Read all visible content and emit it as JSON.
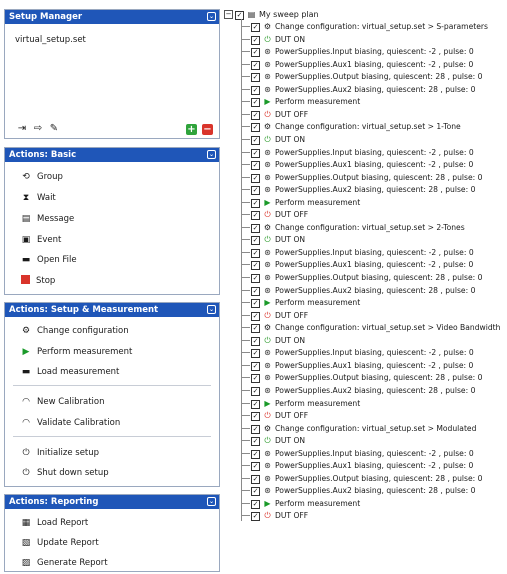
{
  "setup_manager": {
    "title": "Setup Manager",
    "items": [
      "virtual_setup.set"
    ]
  },
  "actions_basic": {
    "title": "Actions: Basic",
    "items": [
      {
        "label": "Group",
        "icon": "group-icon"
      },
      {
        "label": "Wait",
        "icon": "hourglass-icon"
      },
      {
        "label": "Message",
        "icon": "message-icon"
      },
      {
        "label": "Event",
        "icon": "event-icon"
      },
      {
        "label": "Open File",
        "icon": "folder-icon"
      },
      {
        "label": "Stop",
        "icon": "stop-icon"
      }
    ]
  },
  "actions_setup": {
    "title": "Actions: Setup & Measurement",
    "items": [
      {
        "label": "Change configuration",
        "icon": "gear-icon"
      },
      {
        "label": "Perform measurement",
        "icon": "play-icon"
      },
      {
        "label": "Load measurement",
        "icon": "folder-icon"
      },
      {
        "label": "New Calibration",
        "icon": "calibration-icon"
      },
      {
        "label": "Validate Calibration",
        "icon": "calibration-check-icon"
      },
      {
        "label": "Initialize setup",
        "icon": "power-icon"
      },
      {
        "label": "Shut down setup",
        "icon": "power-icon"
      }
    ]
  },
  "actions_reporting": {
    "title": "Actions: Reporting",
    "items": [
      {
        "label": "Load Report",
        "icon": "load-report-icon"
      },
      {
        "label": "Update Report",
        "icon": "update-report-icon"
      },
      {
        "label": "Generate Report",
        "icon": "generate-report-icon"
      }
    ]
  },
  "tree": {
    "root": "My sweep plan",
    "nodes": [
      {
        "type": "config",
        "text": "Change configuration: virtual_setup.set > S-parameters"
      },
      {
        "type": "on",
        "text": "DUT ON"
      },
      {
        "type": "supply",
        "text": "PowerSupplies.Input biasing, quiescent: -2 , pulse: 0"
      },
      {
        "type": "supply",
        "text": "PowerSupplies.Aux1 biasing, quiescent: -2 , pulse: 0"
      },
      {
        "type": "supply",
        "text": "PowerSupplies.Output biasing, quiescent: 28 , pulse: 0"
      },
      {
        "type": "supply",
        "text": "PowerSupplies.Aux2 biasing, quiescent: 28 , pulse: 0"
      },
      {
        "type": "measure",
        "text": "Perform measurement"
      },
      {
        "type": "off",
        "text": "DUT OFF"
      },
      {
        "type": "config",
        "text": "Change configuration: virtual_setup.set > 1-Tone"
      },
      {
        "type": "on",
        "text": "DUT ON"
      },
      {
        "type": "supply",
        "text": "PowerSupplies.Input biasing, quiescent: -2 , pulse: 0"
      },
      {
        "type": "supply",
        "text": "PowerSupplies.Aux1 biasing, quiescent: -2 , pulse: 0"
      },
      {
        "type": "supply",
        "text": "PowerSupplies.Output biasing, quiescent: 28 , pulse: 0"
      },
      {
        "type": "supply",
        "text": "PowerSupplies.Aux2 biasing, quiescent: 28 , pulse: 0"
      },
      {
        "type": "measure",
        "text": "Perform measurement"
      },
      {
        "type": "off",
        "text": "DUT OFF"
      },
      {
        "type": "config",
        "text": "Change configuration: virtual_setup.set > 2-Tones"
      },
      {
        "type": "on",
        "text": "DUT ON"
      },
      {
        "type": "supply",
        "text": "PowerSupplies.Input biasing, quiescent: -2 , pulse: 0"
      },
      {
        "type": "supply",
        "text": "PowerSupplies.Aux1 biasing, quiescent: -2 , pulse: 0"
      },
      {
        "type": "supply",
        "text": "PowerSupplies.Output biasing, quiescent: 28 , pulse: 0"
      },
      {
        "type": "supply",
        "text": "PowerSupplies.Aux2 biasing, quiescent: 28 , pulse: 0"
      },
      {
        "type": "measure",
        "text": "Perform measurement"
      },
      {
        "type": "off",
        "text": "DUT OFF"
      },
      {
        "type": "config",
        "text": "Change configuration: virtual_setup.set > Video Bandwidth"
      },
      {
        "type": "on",
        "text": "DUT ON"
      },
      {
        "type": "supply",
        "text": "PowerSupplies.Input biasing, quiescent: -2 , pulse: 0"
      },
      {
        "type": "supply",
        "text": "PowerSupplies.Aux1 biasing, quiescent: -2 , pulse: 0"
      },
      {
        "type": "supply",
        "text": "PowerSupplies.Output biasing, quiescent: 28 , pulse: 0"
      },
      {
        "type": "supply",
        "text": "PowerSupplies.Aux2 biasing, quiescent: 28 , pulse: 0"
      },
      {
        "type": "measure",
        "text": "Perform measurement"
      },
      {
        "type": "off",
        "text": "DUT OFF"
      },
      {
        "type": "config",
        "text": "Change configuration: virtual_setup.set > Modulated"
      },
      {
        "type": "on",
        "text": "DUT ON"
      },
      {
        "type": "supply",
        "text": "PowerSupplies.Input biasing, quiescent: -2 , pulse: 0"
      },
      {
        "type": "supply",
        "text": "PowerSupplies.Aux1 biasing, quiescent: -2 , pulse: 0"
      },
      {
        "type": "supply",
        "text": "PowerSupplies.Output biasing, quiescent: 28 , pulse: 0"
      },
      {
        "type": "supply",
        "text": "PowerSupplies.Aux2 biasing, quiescent: 28 , pulse: 0"
      },
      {
        "type": "measure",
        "text": "Perform measurement"
      },
      {
        "type": "off",
        "text": "DUT OFF"
      }
    ]
  },
  "colors": {
    "panel_header": "#1f56b8",
    "add_button": "#2fa33b",
    "delete_button": "#d9342b",
    "power_on": "#2a9a2a",
    "power_off": "#d9342b"
  }
}
